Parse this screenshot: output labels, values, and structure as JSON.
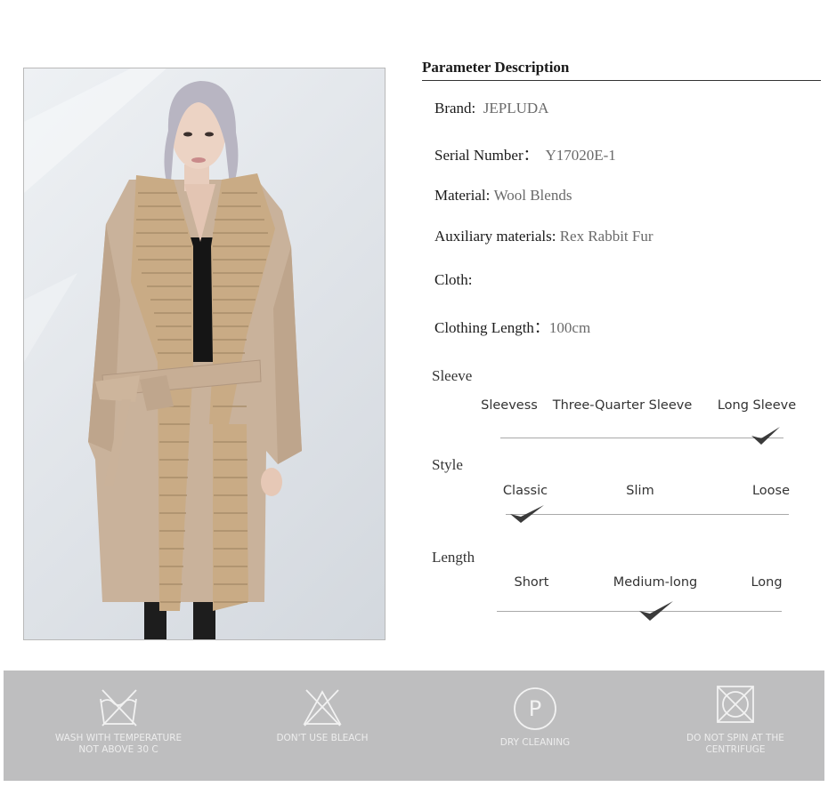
{
  "parameters": {
    "title": "Parameter Description",
    "brand": {
      "label": "Brand:",
      "value": "JEPLUDA"
    },
    "serial_number": {
      "label": "Serial Number：",
      "value": "Y17020E-1"
    },
    "material": {
      "label": "Material:",
      "value": "Wool Blends"
    },
    "auxiliary_materials": {
      "label": "Auxiliary  materials:",
      "value": "Rex Rabbit Fur"
    },
    "cloth": {
      "label": "Cloth:",
      "value": ""
    },
    "clothing_length": {
      "label": "Clothing Length：",
      "value": "100cm"
    }
  },
  "scales": {
    "sleeve": {
      "title": "Sleeve",
      "options": [
        "Sleevess",
        "Three-Quarter Sleeve",
        "Long Sleeve"
      ],
      "selected": "Long Sleeve"
    },
    "style": {
      "title": "Style",
      "options": [
        "Classic",
        "Slim",
        "Loose"
      ],
      "selected": "Classic"
    },
    "length": {
      "title": "Length",
      "options": [
        "Short",
        "Medium-long",
        "Long"
      ],
      "selected": "Medium-long"
    }
  },
  "care": [
    {
      "icon": "no-wash-tub-icon",
      "line1": "WASH WITH TEMPERATURE",
      "line2": "NOT ABOVE 30 C"
    },
    {
      "icon": "no-bleach-triangle-icon",
      "line1": "DON'T USE BLEACH",
      "line2": ""
    },
    {
      "icon": "dry-clean-p-icon",
      "line1": "DRY CLEANING",
      "line2": ""
    },
    {
      "icon": "no-tumble-dry-icon",
      "line1": "DO NOT SPIN AT THE",
      "line2": "CENTRIFUGE"
    }
  ],
  "colors": {
    "care_bar": "#bebebf",
    "care_icon": "#f2f2f2",
    "coat": "#c9b29b",
    "fur": "#c9ab85",
    "check": "#3a3a3a"
  }
}
